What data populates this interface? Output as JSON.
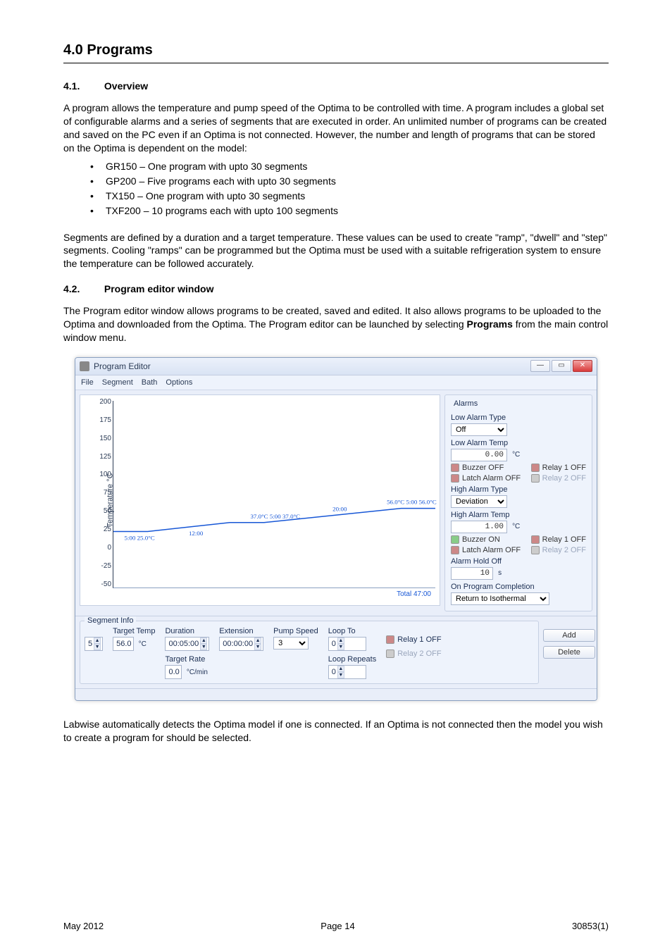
{
  "section_title": "4.0    Programs",
  "subsection_1_num": "4.1.",
  "subsection_1_title": "Overview",
  "para1": "A program allows the temperature and pump speed of the Optima to be controlled with time. A program includes a global set of configurable alarms and a series of segments that are executed in order.  An unlimited number of programs can be created and saved on the PC even if an Optima is not connected.  However, the number and length of programs that can be stored on the Optima is dependent on the model:",
  "bullets": [
    "GR150 – One program with upto 30 segments",
    "GP200 – Five programs each with upto 30 segments",
    "TX150 – One program with upto 30 segments",
    "TXF200 – 10 programs each with upto 100 segments"
  ],
  "para2": "Segments are defined by a duration and a target temperature.  These values can be used to create \"ramp\", \"dwell\" and \"step\" segments.  Cooling \"ramps\" can be programmed but the Optima must be used with a suitable refrigeration system to ensure the temperature can be followed accurately.",
  "subsection_2_num": "4.2.",
  "subsection_2_title": "Program editor window",
  "para3a": "The Program editor window allows programs to be created, saved and edited.  It also allows programs to be uploaded to the Optima and downloaded from the Optima.  The Program editor can be launched by selecting ",
  "para3b_bold": "Programs",
  "para3c": " from the main control window menu.",
  "para4": "Labwise automatically detects the Optima model if one is connected.  If an Optima is not connected then the model you wish to create a program for should be selected.",
  "footer_left": "May 2012",
  "footer_center": "Page 14",
  "footer_right": "30853(1)",
  "win": {
    "title": "Program Editor",
    "menu": {
      "file": "File",
      "segment": "Segment",
      "bath": "Bath",
      "options": "Options"
    },
    "yaxis_label": "Temperature °C",
    "yticks": [
      "200",
      "175",
      "150",
      "125",
      "100",
      "75",
      "50",
      "25",
      "0",
      "-25",
      "-50"
    ],
    "total": "Total 47:00"
  },
  "alarms": {
    "group_title": "Alarms",
    "low_type_lbl": "Low Alarm Type",
    "low_type_val": "Off",
    "low_temp_lbl": "Low Alarm Temp",
    "low_temp_val": "0.00",
    "low_temp_unit": "°C",
    "buzzer_off": "Buzzer  OFF",
    "relay1_off": "Relay 1 OFF",
    "latch_off": "Latch Alarm  OFF",
    "relay2_off": "Relay 2 OFF",
    "high_type_lbl": "High Alarm Type",
    "high_type_val": "Deviation",
    "high_temp_lbl": "High Alarm Temp",
    "high_temp_val": "1.00",
    "high_temp_unit": "°C",
    "buzzer_on": "Buzzer  ON",
    "hold_lbl": "Alarm Hold Off",
    "hold_val": "10",
    "hold_unit": "s",
    "completion_lbl": "On Program Completion",
    "completion_val": "Return to Isothermal"
  },
  "seg": {
    "legend": "Segment Info",
    "idx_val": "5",
    "target_lbl": "Target Temp",
    "target_val": "56.0",
    "target_unit": "°C",
    "duration_lbl": "Duration",
    "duration_val": "00:05:00",
    "extension_lbl": "Extension",
    "extension_val": "00:00:00",
    "rate_lbl": "Target Rate",
    "rate_val": "0.0",
    "rate_unit": "°C/min",
    "pump_lbl": "Pump Speed",
    "pump_val": "3",
    "loopto_lbl": "Loop To",
    "loopto_val": "0",
    "looprep_lbl": "Loop Repeats",
    "looprep_val": "0",
    "relay1": "Relay 1 OFF",
    "relay2": "Relay 2 OFF",
    "add": "Add",
    "delete": "Delete"
  },
  "chart_data": {
    "type": "line",
    "ylim": [
      -50,
      200
    ],
    "y_label": "Temperature °C",
    "annotations": [
      "5:00 25.0°C",
      "12:00",
      "37.0°C  5:00 37.0°C",
      "20:00",
      "56.0°C  5:00 56.0°C"
    ],
    "points": [
      {
        "t_min": 0,
        "temp": 25.0
      },
      {
        "t_min": 5,
        "temp": 25.0
      },
      {
        "t_min": 17,
        "temp": 37.0
      },
      {
        "t_min": 22,
        "temp": 37.0
      },
      {
        "t_min": 42,
        "temp": 56.0
      },
      {
        "t_min": 47,
        "temp": 56.0
      }
    ],
    "total_minutes": 47
  }
}
